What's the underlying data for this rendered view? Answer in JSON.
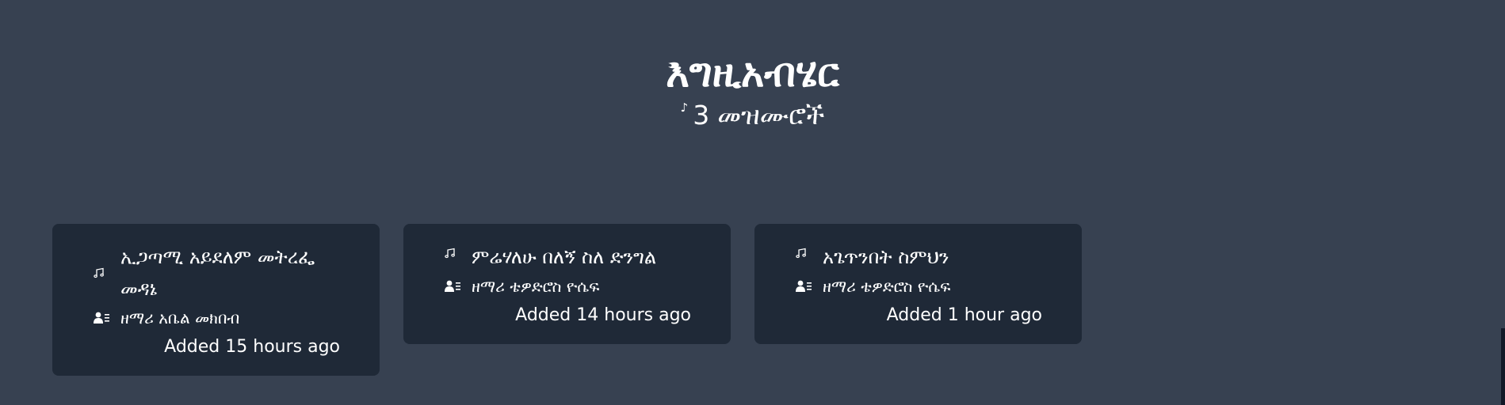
{
  "header": {
    "title": "እግዚአብሄር",
    "count_icon": "music-note-icon",
    "count_number": "3",
    "count_label": "መዝሙሮች"
  },
  "songs": [
    {
      "title": "ኢጋጣሚ አይደለም መትረፌ መዳኔ",
      "title_icon": "music-notes-icon",
      "singer": "ዘማሪ አቤል መክበብ",
      "singer_icon": "user-list-icon",
      "added": "Added 15 hours ago"
    },
    {
      "title": "ምሬሃለሁ በለኝ ስለ ድንግል",
      "title_icon": "music-notes-icon",
      "singer": "ዘማሪ ቴዎድሮስ ዮሴፍ",
      "singer_icon": "user-list-icon",
      "added": "Added 14 hours ago"
    },
    {
      "title": "አጌጥንበት ስምህን",
      "title_icon": "music-notes-icon",
      "singer": "ዘማሪ ቴዎድሮስ ዮሴፍ",
      "singer_icon": "user-list-icon",
      "added": "Added 1 hour ago"
    }
  ]
}
